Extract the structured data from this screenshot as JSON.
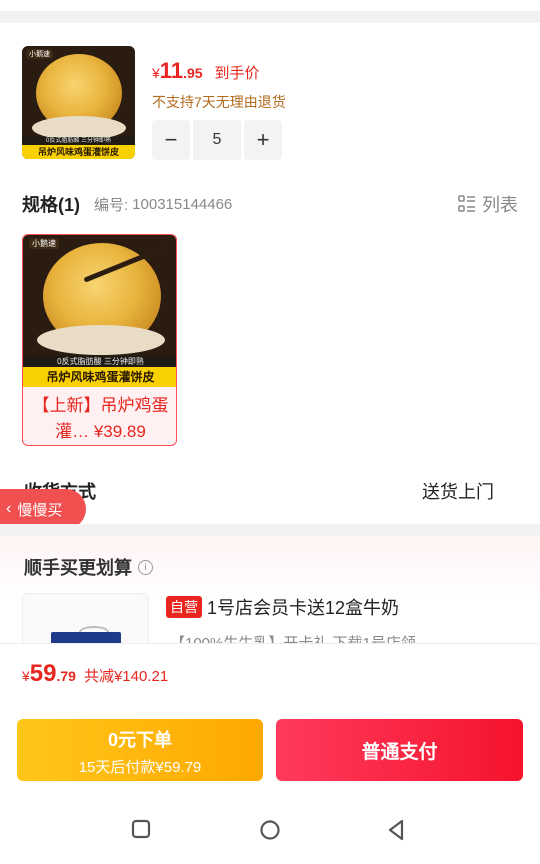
{
  "product": {
    "thumb_tag": "小鹅速",
    "thumb_strip_small": "0反式脂肪酸  三分钟即熟",
    "thumb_strip": "吊炉风味鸡蛋灌饼皮",
    "price_currency": "¥",
    "price_int": "11",
    "price_dec": ".95",
    "price_label": "到手价",
    "no_return": "不支持7天无理由退货",
    "quantity": "5",
    "minus": "−",
    "plus": "+"
  },
  "spec": {
    "title": "规格(1)",
    "code_label": "编号:",
    "code_value": "100315144466",
    "list_label": "列表",
    "item": {
      "tag": "小鹅速",
      "strip_small": "0反式脂肪酸  三分钟即熟",
      "strip": "吊炉风味鸡蛋灌饼皮",
      "name_line1": "【上新】吊炉鸡蛋",
      "name_line2": "灌… ¥39.89"
    }
  },
  "delivery": {
    "label": "收货方式",
    "value": "送货上门"
  },
  "slow_buy": {
    "label": "慢慢买"
  },
  "bundle": {
    "title": "顺手买更划算",
    "info_icon": "i",
    "badge": "自营",
    "product_name": "1号店会员卡送12盒牛奶",
    "product_desc": "【100%生牛乳】开卡礼,下载1号店领"
  },
  "bottom": {
    "currency": "¥",
    "total_int": "59",
    "total_dec": ".79",
    "savings": "共减¥140.21",
    "zero_line1": "0元下单",
    "zero_line2": "15天后付款¥59.79",
    "pay_label": "普通支付"
  },
  "colors": {
    "accent_red": "#e8261f",
    "pay_red": "#f5132c",
    "zero_yellow": "#ffb000",
    "return_warning": "#b36b1d"
  },
  "icons": [
    "minus-icon",
    "plus-icon",
    "list-view-icon",
    "chevron-left-icon",
    "info-icon",
    "square-nav-icon",
    "home-circle-icon",
    "back-triangle-icon"
  ]
}
